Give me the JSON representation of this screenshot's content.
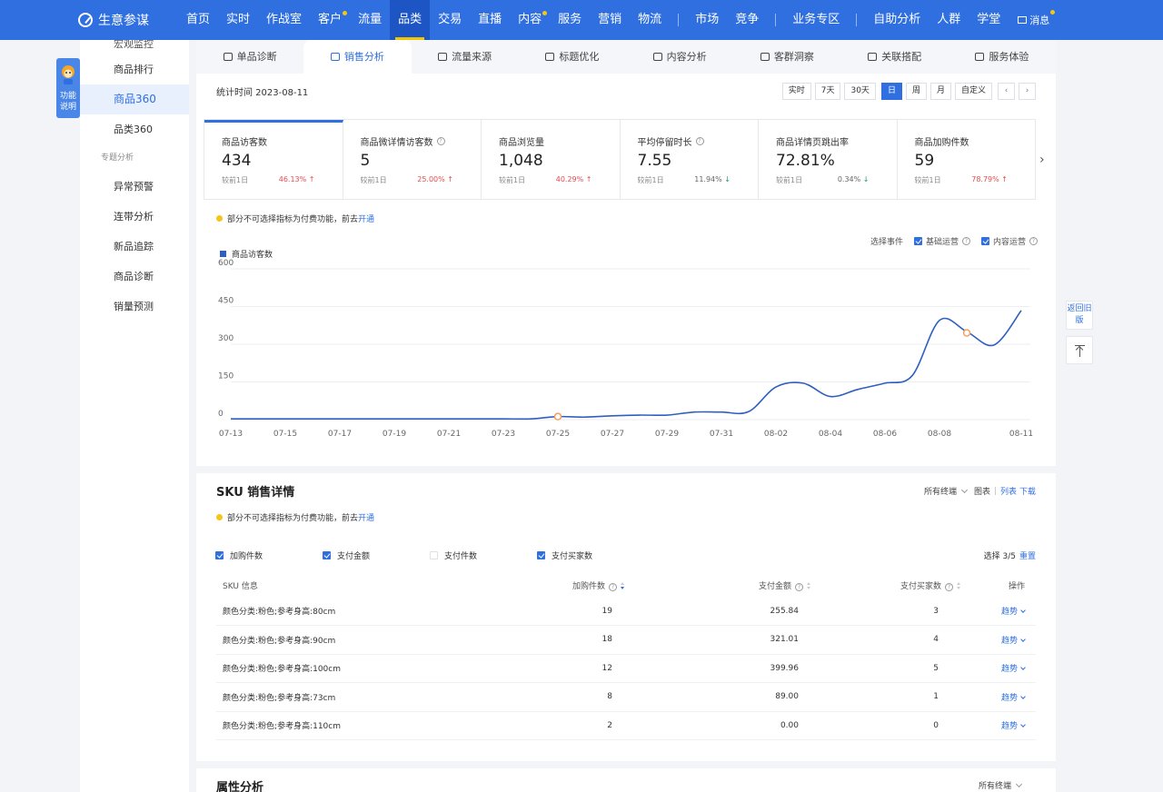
{
  "brand": "生意参谋",
  "nav": {
    "items": [
      {
        "label": "首页",
        "dot": false
      },
      {
        "label": "实时",
        "dot": false
      },
      {
        "label": "作战室",
        "dot": false
      },
      {
        "label": "客户",
        "dot": true
      },
      {
        "label": "流量",
        "dot": false
      },
      {
        "label": "品类",
        "dot": false,
        "active": true
      },
      {
        "label": "交易",
        "dot": false
      },
      {
        "label": "直播",
        "dot": false
      },
      {
        "label": "内容",
        "dot": true
      },
      {
        "label": "服务",
        "dot": false
      },
      {
        "label": "营销",
        "dot": false
      },
      {
        "label": "物流",
        "dot": false
      }
    ],
    "items2": [
      "市场",
      "竞争"
    ],
    "items3": [
      "业务专区"
    ],
    "items4": [
      "自助分析",
      "人群",
      "学堂"
    ],
    "message": "消息"
  },
  "func_tab": "功能说明",
  "sidebar": {
    "cut_item": "宏观监控",
    "items_a": [
      "商品排行",
      "商品360",
      "品类360"
    ],
    "group": "专题分析",
    "items_b": [
      "异常预警",
      "连带分析",
      "新品追踪",
      "商品诊断",
      "销量预测"
    ]
  },
  "tabs": [
    "单品诊断",
    "销售分析",
    "流量来源",
    "标题优化",
    "内容分析",
    "客群洞察",
    "关联搭配",
    "服务体验"
  ],
  "toolbar": {
    "stat_time": "统计时间 2023-08-11",
    "ranges": [
      "实时",
      "7天",
      "30天",
      "日",
      "周",
      "月",
      "自定义"
    ],
    "active_range": "日"
  },
  "metrics": [
    {
      "label": "商品访客数",
      "value": "434",
      "compare": "较前1日",
      "pct": "46.13%",
      "dir": "up",
      "help": false
    },
    {
      "label": "商品微详情访客数",
      "value": "5",
      "compare": "较前1日",
      "pct": "25.00%",
      "dir": "up",
      "help": true
    },
    {
      "label": "商品浏览量",
      "value": "1,048",
      "compare": "较前1日",
      "pct": "40.29%",
      "dir": "up",
      "help": false
    },
    {
      "label": "平均停留时长",
      "value": "7.55",
      "compare": "较前1日",
      "pct": "11.94%",
      "dir": "down",
      "help": true
    },
    {
      "label": "商品详情页跳出率",
      "value": "72.81%",
      "compare": "较前1日",
      "pct": "0.34%",
      "dir": "down",
      "help": false
    },
    {
      "label": "商品加购件数",
      "value": "59",
      "compare": "较前1日",
      "pct": "78.79%",
      "dir": "up",
      "help": false
    }
  ],
  "notice": {
    "text": "部分不可选择指标为付费功能，前去",
    "link": "开通"
  },
  "events": {
    "label": "选择事件",
    "options": [
      {
        "label": "基础运营",
        "checked": true
      },
      {
        "label": "内容运营",
        "checked": true
      }
    ]
  },
  "colors": {
    "primary": "#2f6fe0",
    "line": "#2f5fc0",
    "up": "#e34d4d",
    "down": "#20a162",
    "marker": "#f0a060"
  },
  "chart_data": {
    "type": "line",
    "legend": "商品访客数",
    "x": [
      "07-13",
      "07-14",
      "07-15",
      "07-16",
      "07-17",
      "07-18",
      "07-19",
      "07-20",
      "07-21",
      "07-22",
      "07-23",
      "07-24",
      "07-25",
      "07-26",
      "07-27",
      "07-28",
      "07-29",
      "07-30",
      "07-31",
      "08-01",
      "08-02",
      "08-03",
      "08-04",
      "08-05",
      "08-06",
      "08-07",
      "08-08",
      "08-09",
      "08-10",
      "08-11"
    ],
    "xticks": [
      "07-13",
      "07-15",
      "07-17",
      "07-19",
      "07-21",
      "07-23",
      "07-25",
      "07-27",
      "07-29",
      "07-31",
      "08-02",
      "08-04",
      "08-06",
      "08-08",
      "08-11"
    ],
    "series": [
      {
        "values": [
          3,
          3,
          3,
          3,
          3,
          3,
          3,
          3,
          3,
          3,
          3,
          3,
          12,
          10,
          15,
          18,
          18,
          30,
          30,
          32,
          130,
          145,
          92,
          120,
          145,
          175,
          395,
          350,
          297,
          434
        ]
      }
    ],
    "markers": [
      {
        "x": "07-25",
        "y": 12
      },
      {
        "x": "08-09",
        "y": 345
      }
    ],
    "ylim": [
      0,
      600
    ],
    "yticks": [
      0,
      150,
      300,
      450,
      600
    ],
    "grid": true
  },
  "sku": {
    "title": "SKU 销售详情",
    "tools": {
      "terminal": "所有终端",
      "chart": "图表",
      "list": "列表",
      "download": "下载"
    },
    "checkboxes": [
      {
        "label": "加购件数",
        "checked": true
      },
      {
        "label": "支付金额",
        "checked": true
      },
      {
        "label": "支付件数",
        "checked": false
      },
      {
        "label": "支付买家数",
        "checked": true
      }
    ],
    "select_count": "选择 3/5",
    "reset": "重置",
    "headers": [
      "SKU 信息",
      "加购件数",
      "支付金额",
      "支付买家数",
      "操作"
    ],
    "rows": [
      {
        "name": "颜色分类:粉色;参考身高:80cm",
        "cart": "19",
        "amount": "255.84",
        "buyers": "3",
        "trend": "趋势"
      },
      {
        "name": "颜色分类:粉色;参考身高:90cm",
        "cart": "18",
        "amount": "321.01",
        "buyers": "4",
        "trend": "趋势"
      },
      {
        "name": "颜色分类:粉色;参考身高:100cm",
        "cart": "12",
        "amount": "399.96",
        "buyers": "5",
        "trend": "趋势"
      },
      {
        "name": "颜色分类:粉色;参考身高:73cm",
        "cart": "8",
        "amount": "89.00",
        "buyers": "1",
        "trend": "趋势"
      },
      {
        "name": "颜色分类:粉色;参考身高:110cm",
        "cart": "2",
        "amount": "0.00",
        "buyers": "0",
        "trend": "趋势"
      }
    ]
  },
  "attr": {
    "title": "属性分析",
    "terminal": "所有终端"
  },
  "float": {
    "back": "返回旧版"
  }
}
